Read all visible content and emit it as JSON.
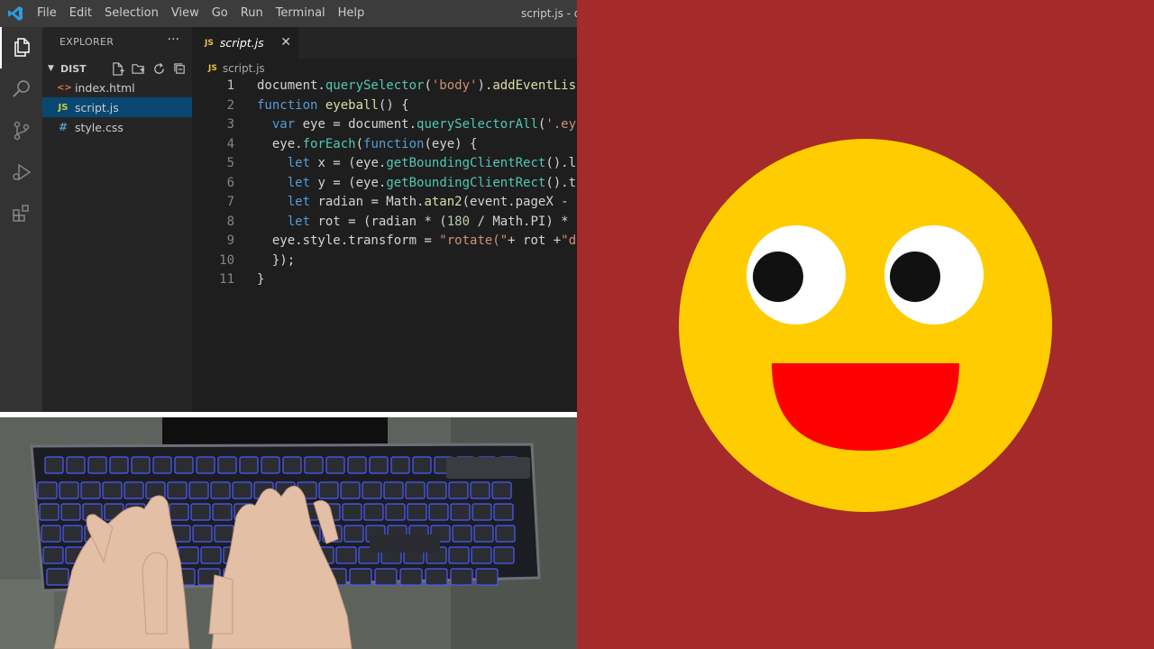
{
  "window": {
    "title": "script.js - dis",
    "menu": [
      "File",
      "Edit",
      "Selection",
      "View",
      "Go",
      "Run",
      "Terminal",
      "Help"
    ]
  },
  "activity_bar": {
    "items": [
      {
        "icon": "files-icon",
        "active": true
      },
      {
        "icon": "search-icon",
        "active": false
      },
      {
        "icon": "source-control-icon",
        "active": false
      },
      {
        "icon": "run-debug-icon",
        "active": false
      },
      {
        "icon": "extensions-icon",
        "active": false
      }
    ]
  },
  "explorer": {
    "header": "EXPLORER",
    "more": "···",
    "folder": "DIST",
    "files": [
      {
        "name": "index.html",
        "icon_text": "<>",
        "icon_color": "#e37933",
        "selected": false
      },
      {
        "name": "script.js",
        "icon_text": "JS",
        "icon_color": "#cbcb41",
        "selected": true
      },
      {
        "name": "style.css",
        "icon_text": "#",
        "icon_color": "#519aba",
        "selected": false
      }
    ]
  },
  "editor": {
    "tab": {
      "label": "script.js",
      "icon_text": "JS",
      "close": "✕"
    },
    "breadcrumb": {
      "icon_text": "JS",
      "label": "script.js"
    },
    "current_line": 1,
    "lines": [
      [
        [
          "document.",
          ""
        ],
        [
          "querySelector",
          "m"
        ],
        [
          "(",
          ""
        ],
        [
          "'body'",
          "s"
        ],
        [
          ").",
          ""
        ],
        [
          "addEventLis",
          "f"
        ]
      ],
      [
        [
          "function",
          "k"
        ],
        [
          " ",
          ""
        ],
        [
          "eyeball",
          "f"
        ],
        [
          "() {",
          ""
        ]
      ],
      [
        [
          "  ",
          ""
        ],
        [
          "var",
          "k"
        ],
        [
          " eye = document.",
          ""
        ],
        [
          "querySelectorAll",
          "m"
        ],
        [
          "(",
          ""
        ],
        [
          "'.ey",
          "s"
        ]
      ],
      [
        [
          "  eye.",
          ""
        ],
        [
          "forEach",
          "m"
        ],
        [
          "(",
          ""
        ],
        [
          "function",
          "k"
        ],
        [
          "(eye) {",
          ""
        ]
      ],
      [
        [
          "    ",
          ""
        ],
        [
          "let",
          "k"
        ],
        [
          " x = (eye.",
          ""
        ],
        [
          "getBoundingClientRect",
          "m"
        ],
        [
          "().",
          ""
        ],
        [
          "l",
          ""
        ]
      ],
      [
        [
          "    ",
          ""
        ],
        [
          "let",
          "k"
        ],
        [
          " y = (eye.",
          ""
        ],
        [
          "getBoundingClientRect",
          "m"
        ],
        [
          "().",
          ""
        ],
        [
          "t",
          ""
        ]
      ],
      [
        [
          "    ",
          ""
        ],
        [
          "let",
          "k"
        ],
        [
          " radian = Math.",
          ""
        ],
        [
          "atan2",
          "f"
        ],
        [
          "(event.pageX -",
          ""
        ]
      ],
      [
        [
          "    ",
          ""
        ],
        [
          "let",
          "k"
        ],
        [
          " rot = (radian * (",
          ""
        ],
        [
          "180",
          "n"
        ],
        [
          " / Math.PI) *",
          ""
        ]
      ],
      [
        [
          "  eye.style.transform = ",
          ""
        ],
        [
          "\"rotate(\"",
          "s"
        ],
        [
          "+ rot +",
          ""
        ],
        [
          "\"d",
          "s"
        ]
      ],
      [
        [
          "  });",
          ""
        ]
      ],
      [
        [
          "}",
          ""
        ]
      ]
    ]
  },
  "preview": {
    "background": "#a52a2a",
    "face_color": "#ffcc00",
    "eye_white": "#ffffff",
    "pupil_color": "#111111",
    "mouth_color": "#ff0000"
  }
}
